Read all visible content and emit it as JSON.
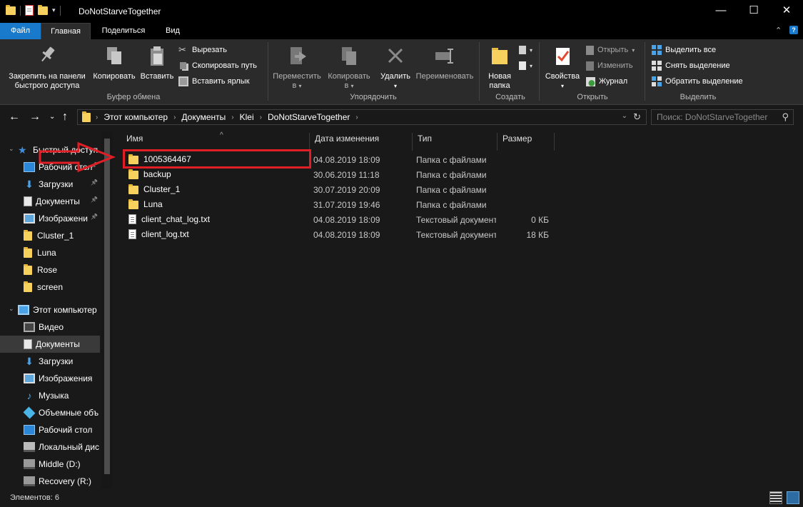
{
  "window": {
    "title": "DoNotStarveTogether",
    "minimize": "—",
    "maximize": "☐",
    "close": "✕"
  },
  "tabs": {
    "file": "Файл",
    "home": "Главная",
    "share": "Поделиться",
    "view": "Вид",
    "collapse_glyph": "⌃",
    "help_glyph": "?"
  },
  "ribbon": {
    "clipboard": {
      "label": "Буфер обмена",
      "pin_line1": "Закрепить на панели",
      "pin_line2": "быстрого доступа",
      "copy": "Копировать",
      "paste": "Вставить",
      "cut": "Вырезать",
      "copy_path": "Скопировать путь",
      "paste_shortcut": "Вставить ярлык"
    },
    "organize": {
      "label": "Упорядочить",
      "move_line1": "Переместить",
      "move_line2": "в",
      "copyto_line1": "Копировать",
      "copyto_line2": "в",
      "delete": "Удалить",
      "rename": "Переименовать"
    },
    "new": {
      "label": "Создать",
      "new_folder_line1": "Новая",
      "new_folder_line2": "папка"
    },
    "open": {
      "label": "Открыть",
      "properties": "Свойства",
      "open": "Открыть",
      "edit": "Изменить",
      "history": "Журнал"
    },
    "select": {
      "label": "Выделить",
      "select_all": "Выделить все",
      "select_none": "Снять выделение",
      "invert": "Обратить выделение"
    }
  },
  "address": {
    "crumbs": [
      "Этот компьютер",
      "Документы",
      "Klei",
      "DoNotStarveTogether"
    ],
    "search_placeholder": "Поиск: DoNotStarveTogether"
  },
  "nav": {
    "quick_access": "Быстрый доступ",
    "quick_items": [
      {
        "label": "Рабочий стол",
        "icon": "desktop-icon"
      },
      {
        "label": "Загрузки",
        "icon": "downloads-icon"
      },
      {
        "label": "Документы",
        "icon": "documents-icon"
      },
      {
        "label": "Изображени",
        "icon": "pictures-icon"
      },
      {
        "label": "Cluster_1",
        "icon": "folder-icon"
      },
      {
        "label": "Luna",
        "icon": "folder-icon"
      },
      {
        "label": "Rose",
        "icon": "folder-icon"
      },
      {
        "label": "screen",
        "icon": "folder-icon"
      }
    ],
    "this_pc": "Этот компьютер",
    "pc_items": [
      {
        "label": "Видео",
        "icon": "videos-icon"
      },
      {
        "label": "Документы",
        "icon": "documents-icon"
      },
      {
        "label": "Загрузки",
        "icon": "downloads-icon"
      },
      {
        "label": "Изображения",
        "icon": "pictures-icon"
      },
      {
        "label": "Музыка",
        "icon": "music-icon"
      },
      {
        "label": "Объемные объ",
        "icon": "3d-objects-icon"
      },
      {
        "label": "Рабочий стол",
        "icon": "desktop-icon"
      },
      {
        "label": "Локальный дис",
        "icon": "local-disk-icon"
      },
      {
        "label": "Middle (D:)",
        "icon": "drive-icon"
      },
      {
        "label": "Recovery (R:)",
        "icon": "drive-icon"
      }
    ]
  },
  "columns": {
    "name": "Имя",
    "date": "Дата изменения",
    "type": "Тип",
    "size": "Размер"
  },
  "files": [
    {
      "name": "1005364467",
      "date": "04.08.2019 18:09",
      "type": "Папка с файлами",
      "size": "",
      "kind": "folder"
    },
    {
      "name": "backup",
      "date": "30.06.2019 11:18",
      "type": "Папка с файлами",
      "size": "",
      "kind": "folder"
    },
    {
      "name": "Cluster_1",
      "date": "30.07.2019 20:09",
      "type": "Папка с файлами",
      "size": "",
      "kind": "folder"
    },
    {
      "name": "Luna",
      "date": "31.07.2019 19:46",
      "type": "Папка с файлами",
      "size": "",
      "kind": "folder"
    },
    {
      "name": "client_chat_log.txt",
      "date": "04.08.2019 18:09",
      "type": "Текстовый документ",
      "size": "0 КБ",
      "kind": "text"
    },
    {
      "name": "client_log.txt",
      "date": "04.08.2019 18:09",
      "type": "Текстовый документ",
      "size": "18 КБ",
      "kind": "text"
    }
  ],
  "status": {
    "count": "Элементов: 6"
  },
  "colors": {
    "accent": "#1979ca",
    "annotation": "#e01e25",
    "folder": "#f7d15e"
  }
}
